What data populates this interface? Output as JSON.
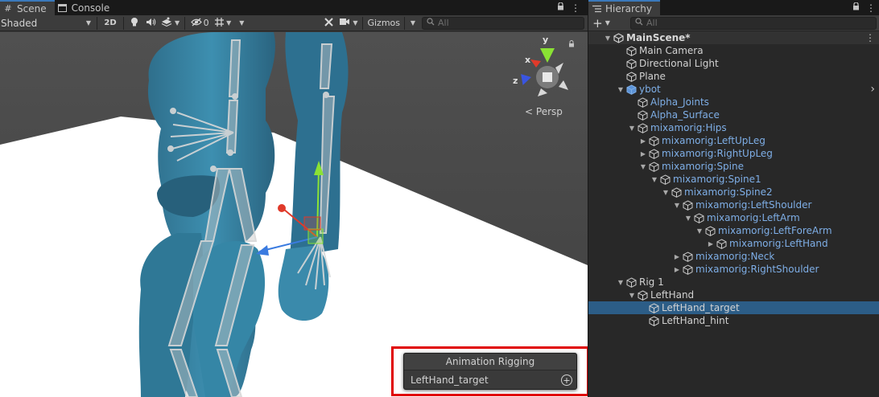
{
  "scene_tabs": [
    {
      "label": "Scene",
      "icon": "hash-icon",
      "active": true
    },
    {
      "label": "Console",
      "icon": "console-icon",
      "active": false
    }
  ],
  "scene_toolbar": {
    "shading_mode": "Shaded",
    "mode_2d": "2D",
    "hidden_count": "0",
    "gizmos_label": "Gizmos",
    "search_placeholder": "All"
  },
  "viewport": {
    "projection_label": "Persp",
    "gizmo_axes": {
      "x": "x",
      "y": "y",
      "z": "z"
    }
  },
  "overlay": {
    "title": "Animation Rigging",
    "item": "LeftHand_target"
  },
  "hierarchy": {
    "tab_label": "Hierarchy",
    "search_placeholder": "All",
    "rows": [
      {
        "label": "MainScene*",
        "depth": 0,
        "fold": "open",
        "kind": "scene"
      },
      {
        "label": "Main Camera",
        "depth": 1,
        "fold": "none",
        "kind": "object"
      },
      {
        "label": "Directional Light",
        "depth": 1,
        "fold": "none",
        "kind": "object"
      },
      {
        "label": "Plane",
        "depth": 1,
        "fold": "none",
        "kind": "object"
      },
      {
        "label": "ybot",
        "depth": 1,
        "fold": "open",
        "kind": "prefab-root"
      },
      {
        "label": "Alpha_Joints",
        "depth": 2,
        "fold": "none",
        "kind": "prefab"
      },
      {
        "label": "Alpha_Surface",
        "depth": 2,
        "fold": "none",
        "kind": "prefab"
      },
      {
        "label": "mixamorig:Hips",
        "depth": 2,
        "fold": "open",
        "kind": "prefab"
      },
      {
        "label": "mixamorig:LeftUpLeg",
        "depth": 3,
        "fold": "closed",
        "kind": "prefab"
      },
      {
        "label": "mixamorig:RightUpLeg",
        "depth": 3,
        "fold": "closed",
        "kind": "prefab"
      },
      {
        "label": "mixamorig:Spine",
        "depth": 3,
        "fold": "open",
        "kind": "prefab"
      },
      {
        "label": "mixamorig:Spine1",
        "depth": 4,
        "fold": "open",
        "kind": "prefab"
      },
      {
        "label": "mixamorig:Spine2",
        "depth": 5,
        "fold": "open",
        "kind": "prefab"
      },
      {
        "label": "mixamorig:LeftShoulder",
        "depth": 6,
        "fold": "open",
        "kind": "prefab"
      },
      {
        "label": "mixamorig:LeftArm",
        "depth": 7,
        "fold": "open",
        "kind": "prefab"
      },
      {
        "label": "mixamorig:LeftForeArm",
        "depth": 8,
        "fold": "open",
        "kind": "prefab"
      },
      {
        "label": "mixamorig:LeftHand",
        "depth": 9,
        "fold": "closed",
        "kind": "prefab"
      },
      {
        "label": "mixamorig:Neck",
        "depth": 6,
        "fold": "closed",
        "kind": "prefab"
      },
      {
        "label": "mixamorig:RightShoulder",
        "depth": 6,
        "fold": "closed",
        "kind": "prefab"
      },
      {
        "label": "Rig 1",
        "depth": 1,
        "fold": "open",
        "kind": "rig"
      },
      {
        "label": "LeftHand",
        "depth": 2,
        "fold": "open",
        "kind": "object"
      },
      {
        "label": "LeftHand_target",
        "depth": 3,
        "fold": "none",
        "kind": "object",
        "selected": true
      },
      {
        "label": "LeftHand_hint",
        "depth": 3,
        "fold": "none",
        "kind": "object"
      }
    ]
  },
  "colors": {
    "selection": "#2c5d87",
    "prefab_text": "#7eaee6",
    "highlight_box": "#e00000",
    "tab_accent": "#3a79bb"
  }
}
